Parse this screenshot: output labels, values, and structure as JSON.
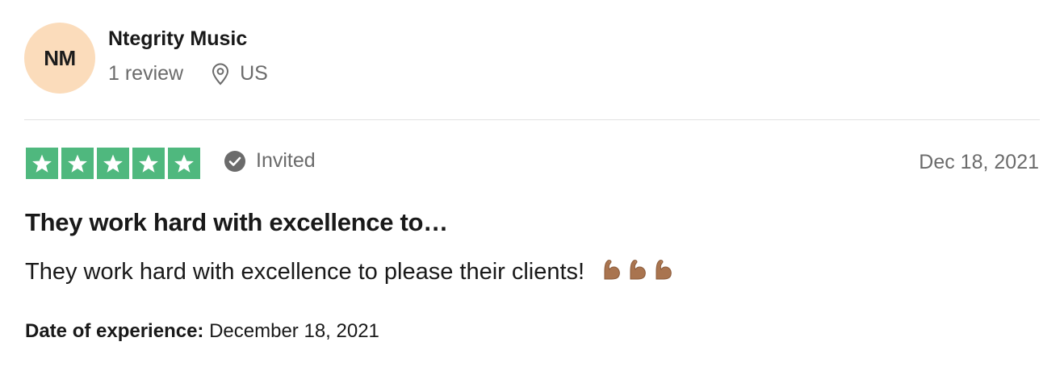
{
  "consumer": {
    "initials": "NM",
    "name": "Ntegrity Music",
    "review_count": "1 review",
    "location": "US",
    "avatar_color": "#fbdcbb"
  },
  "rating": {
    "stars": 5,
    "max_stars": 5,
    "star_color": "#4fb87e",
    "badge": "Invited",
    "date": "Dec 18, 2021"
  },
  "review": {
    "title": "They work hard with excellence to…",
    "text": "They work hard with excellence to please their clients!",
    "emoji_icons": [
      "flexed-biceps-icon",
      "flexed-biceps-icon",
      "flexed-biceps-icon"
    ]
  },
  "experience": {
    "label": "Date of experience:",
    "date": "December 18, 2021"
  },
  "icons": {
    "location": "location-pin-icon",
    "badge": "check-circle-icon",
    "star": "star-icon"
  }
}
